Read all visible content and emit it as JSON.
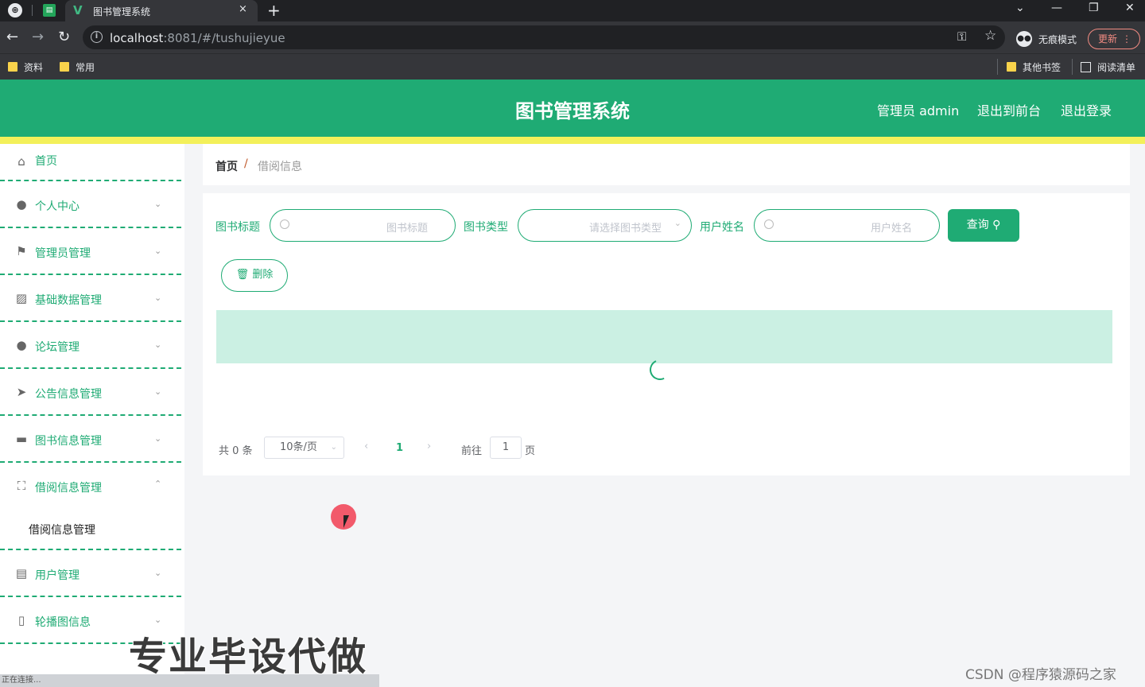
{
  "browser": {
    "tab_title": "图书管理系统",
    "tab_logo": "V",
    "close_glyph": "×",
    "new_tab_glyph": "+",
    "url_host": "localhost",
    "url_rest": ":8081/#/tushujieyue",
    "incognito_label": "无痕模式",
    "update_label": "更新",
    "bookmarks_left": [
      "资料",
      "常用"
    ],
    "bookmark_other": "其他书签",
    "reading_list": "阅读清单"
  },
  "header": {
    "title": "图书管理系统",
    "admin": "管理员 admin",
    "to_front": "退出到前台",
    "logout": "退出登录"
  },
  "sidebar": {
    "items": [
      {
        "label": "首页",
        "icon": "home-icon"
      },
      {
        "label": "个人中心",
        "icon": "user-icon"
      },
      {
        "label": "管理员管理",
        "icon": "flag-icon"
      },
      {
        "label": "基础数据管理",
        "icon": "chart-icon"
      },
      {
        "label": "论坛管理",
        "icon": "user-icon"
      },
      {
        "label": "公告信息管理",
        "icon": "send-icon"
      },
      {
        "label": "图书信息管理",
        "icon": "briefcase-icon"
      },
      {
        "label": "借阅信息管理",
        "icon": "fullscreen-icon"
      },
      {
        "label": "用户管理",
        "icon": "document-icon"
      },
      {
        "label": "轮播图信息",
        "icon": "phone-icon"
      }
    ],
    "sub_item": "借阅信息管理"
  },
  "breadcrumb": {
    "home": "首页",
    "separator": "/",
    "current": "借阅信息"
  },
  "search": {
    "title_label": "图书标题",
    "title_placeholder": "图书标题",
    "type_label": "图书类型",
    "type_placeholder": "请选择图书类型",
    "user_label": "用户姓名",
    "user_placeholder": "用户姓名",
    "query_button": "查询"
  },
  "actions": {
    "delete_button": "删除"
  },
  "pager": {
    "total": "共 0 条",
    "page_size": "10条/页",
    "current_page": "1",
    "goto_label": "前往",
    "goto_value": "1",
    "page_suffix": "页"
  },
  "overlay": {
    "watermark": "专业毕设代做",
    "status": "正在连接...",
    "credit": "CSDN @程序猿源码之家"
  },
  "colors": {
    "primary": "#1fab74",
    "accent_strip": "#f3f05a"
  }
}
